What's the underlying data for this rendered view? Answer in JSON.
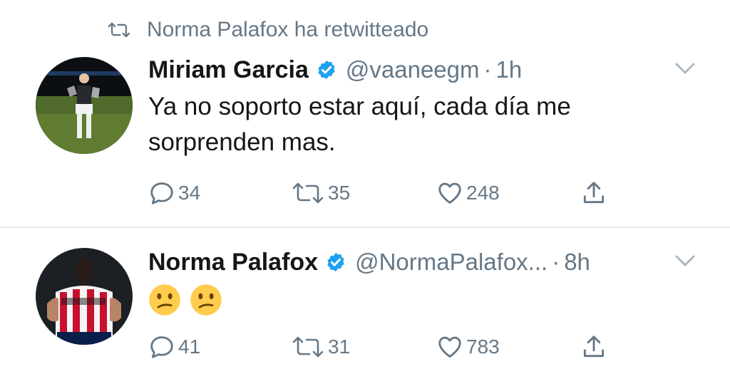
{
  "tweets": [
    {
      "retweet_context": "Norma Palafox ha retwitteado",
      "name": "Miriam Garcia",
      "handle": "@vaaneegm",
      "separator": "·",
      "time": "1h",
      "text": "Ya no soporto estar aquí, cada día me sorprenden mas.",
      "replies": "34",
      "retweets": "35",
      "likes": "248"
    },
    {
      "name": "Norma Palafox",
      "handle": "@NormaPalafox...",
      "separator": "·",
      "time": "8h",
      "emoji": [
        "confused-face",
        "confused-face"
      ],
      "replies": "41",
      "retweets": "31",
      "likes": "783"
    }
  ],
  "colors": {
    "text": "#14171a",
    "muted": "#657786",
    "verified": "#1da1f2",
    "divider": "#e6ecf0"
  }
}
